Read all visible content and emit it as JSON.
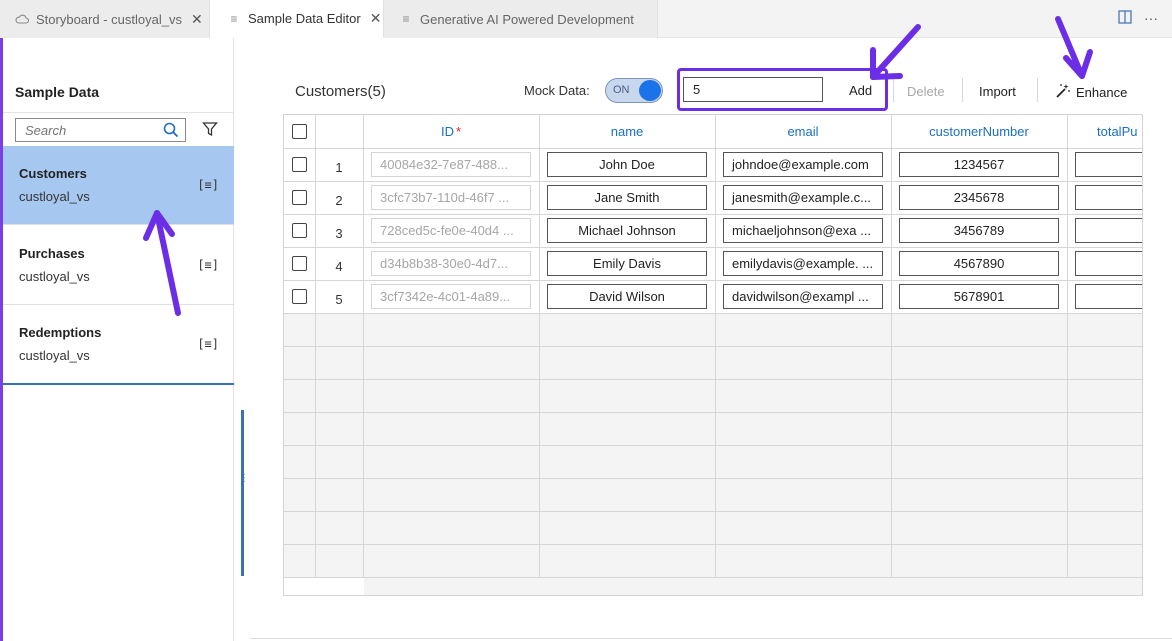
{
  "tabs": [
    {
      "label": "Storyboard - custloyal_vs",
      "icon": "cloud-icon",
      "closable": true
    },
    {
      "label": "Sample Data Editor",
      "icon": "document-icon",
      "closable": true,
      "active": true
    },
    {
      "label": "Generative AI Powered Development",
      "icon": "document-icon",
      "closable": false
    }
  ],
  "sidebar": {
    "title": "Sample Data",
    "search_placeholder": "Search",
    "entities": [
      {
        "name": "Customers",
        "service": "custloyal_vs",
        "selected": true
      },
      {
        "name": "Purchases",
        "service": "custloyal_vs"
      },
      {
        "name": "Redemptions",
        "service": "custloyal_vs"
      }
    ]
  },
  "toolbar": {
    "title": "Customers(5)",
    "mock_label": "Mock Data:",
    "toggle_label": "ON",
    "add_count": "5",
    "add_label": "Add",
    "delete_label": "Delete",
    "import_label": "Import",
    "enhance_label": "Enhance"
  },
  "grid": {
    "columns": [
      "ID",
      "name",
      "email",
      "customerNumber",
      "totalPu"
    ],
    "rows": [
      {
        "num": "1",
        "id": "40084e32-7e87-488...",
        "name": "John Doe",
        "email": "johndoe@example.com",
        "customerNumber": "1234567"
      },
      {
        "num": "2",
        "id": "3cfc73b7-110d-46f7 ...",
        "name": "Jane Smith",
        "email": "janesmith@example.c...",
        "customerNumber": "2345678"
      },
      {
        "num": "3",
        "id": "728ced5c-fe0e-40d4 ...",
        "name": "Michael Johnson",
        "email": "michaeljohnson@exa ...",
        "customerNumber": "3456789"
      },
      {
        "num": "4",
        "id": "d34b8b38-30e0-4d7...",
        "name": "Emily Davis",
        "email": "emilydavis@example. ...",
        "customerNumber": "4567890"
      },
      {
        "num": "5",
        "id": "3cf7342e-4c01-4a89...",
        "name": "David Wilson",
        "email": "davidwilson@exampl ...",
        "customerNumber": "5678901"
      }
    ]
  },
  "colors": {
    "accent": "#7b3fe4",
    "selected": "#a6c8f0",
    "link": "#1a6fc4",
    "annotation": "#6b2ee6"
  }
}
